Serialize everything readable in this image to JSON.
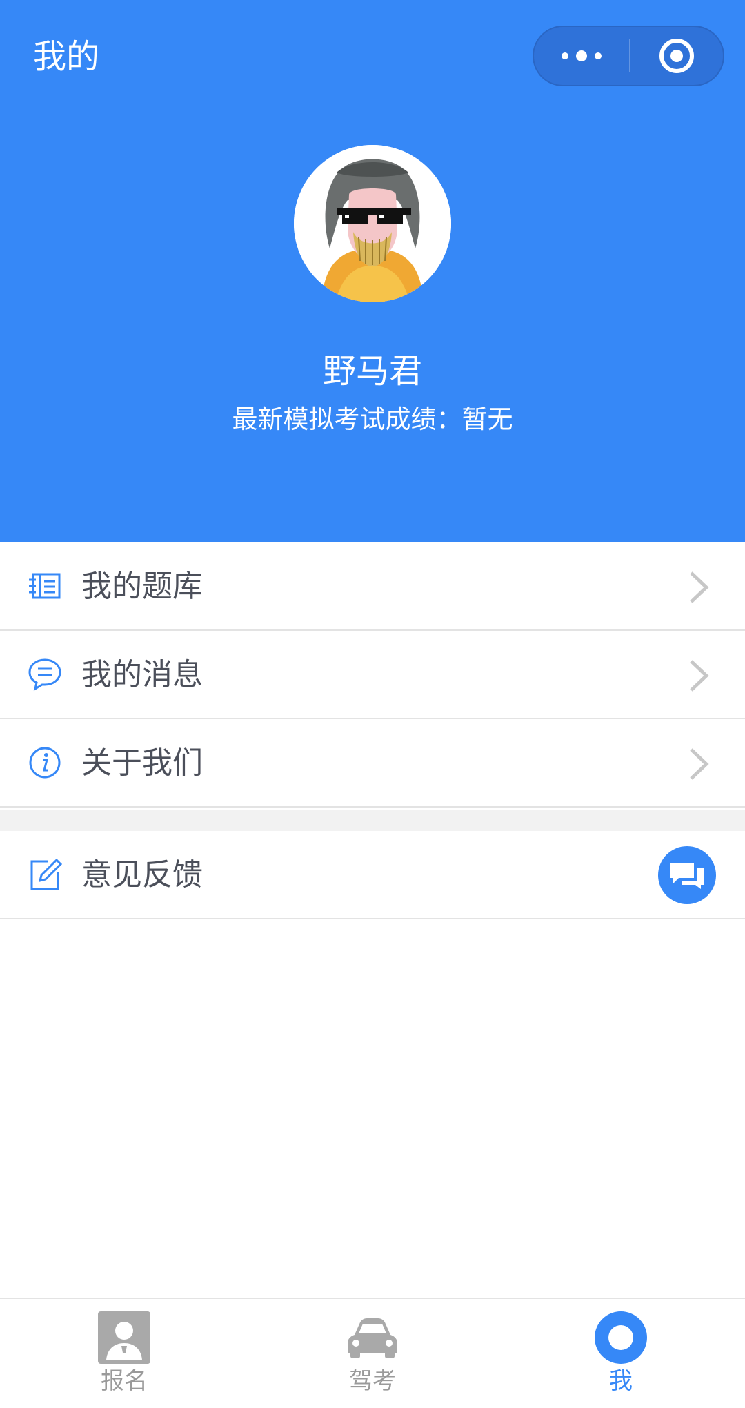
{
  "header": {
    "title": "我的",
    "more_icon": "more-dots-icon",
    "close_icon": "target-circle-icon",
    "bg_color": "#3688f7"
  },
  "profile": {
    "avatar_icon": "cartoon-avatar",
    "name": "野马君",
    "score_line": "最新模拟考试成绩：暂无"
  },
  "menu": [
    {
      "label": "我的题库",
      "icon": "question-bank-icon",
      "arrow": "chevron-right-icon"
    },
    {
      "label": "我的消息",
      "icon": "message-bubble-icon",
      "arrow": "chevron-right-icon"
    },
    {
      "label": "关于我们",
      "icon": "info-icon",
      "arrow": "chevron-right-icon"
    }
  ],
  "feedback": {
    "label": "意见反馈",
    "icon": "edit-icon",
    "action_icon": "chat-bubbles-icon"
  },
  "tabbar": {
    "tabs": [
      {
        "label": "报名",
        "icon": "person-card-icon",
        "active": false
      },
      {
        "label": "驾考",
        "icon": "car-icon",
        "active": false
      },
      {
        "label": "我",
        "icon": "circle-dot-icon",
        "active": true
      }
    ],
    "active_color": "#3688f7",
    "inactive_color": "#9a9a9a"
  }
}
